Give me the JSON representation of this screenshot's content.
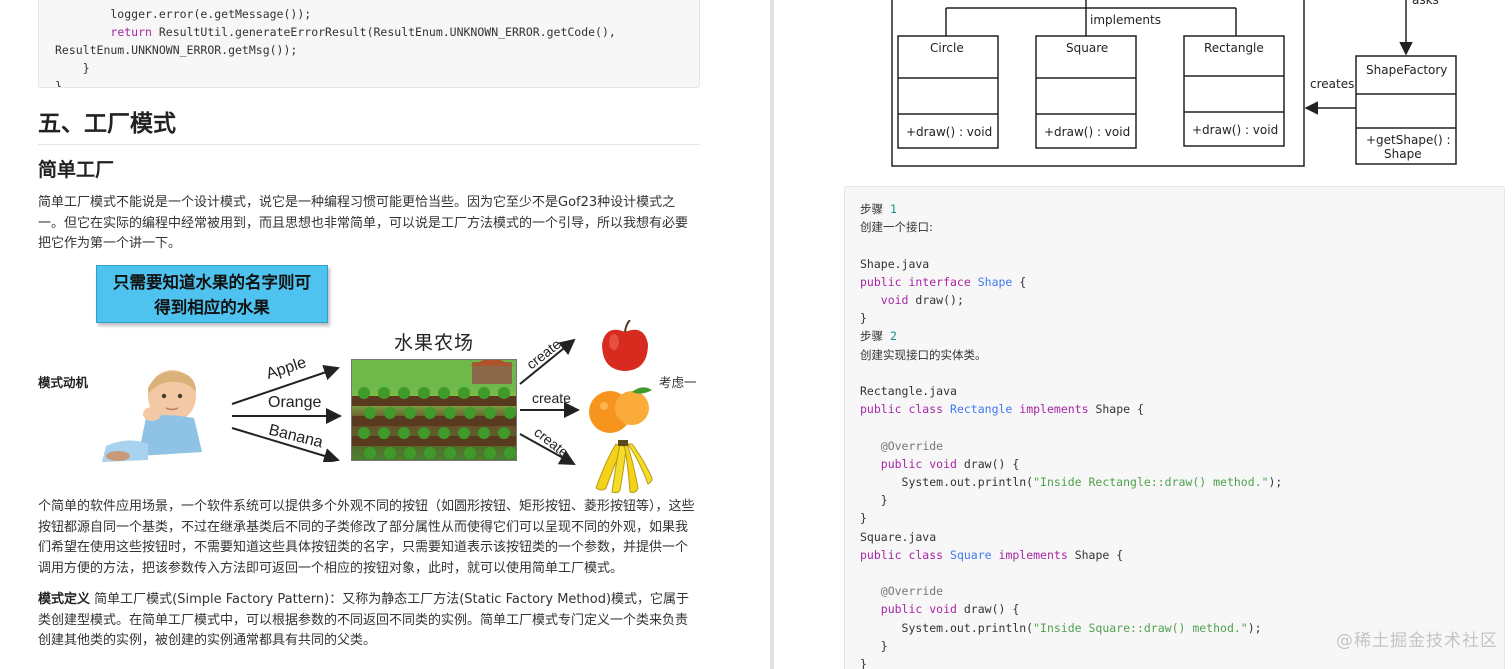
{
  "left": {
    "code_lines": [
      "        logger.error(e.getMessage());",
      "        return ResultUtil.generateErrorResult(ResultEnum.UNKNOWN_ERROR.getCode(),",
      "ResultEnum.UNKNOWN_ERROR.getMsg());",
      "    }",
      "}"
    ],
    "heading": "五、工厂模式",
    "subheading": "简单工厂",
    "intro": "简单工厂模式不能说是一个设计模式，说它是一种编程习惯可能更恰当些。因为它至少不是Gof23种设计模式之一。但它在实际的编程中经常被用到，而且思想也非常简单，可以说是工厂方法模式的一个引导，所以我想有必要把它作为第一个讲一下。",
    "figure": {
      "caption_line1": "只需要知道水果的名字则可",
      "caption_line2": "得到相应的水果",
      "farm_title": "水果农场",
      "inputs": [
        "Apple",
        "Orange",
        "Banana"
      ],
      "create_labels": [
        "create",
        "create",
        "create"
      ]
    },
    "motivation_label": "模式动机",
    "motivation_tail": "考虑一",
    "motivation_text": "个简单的软件应用场景，一个软件系统可以提供多个外观不同的按钮（如圆形按钮、矩形按钮、菱形按钮等），这些按钮都源自同一个基类，不过在继承基类后不同的子类修改了部分属性从而使得它们可以呈现不同的外观，如果我们希望在使用这些按钮时，不需要知道这些具体按钮类的名字，只需要知道表示该按钮类的一个参数，并提供一个调用方便的方法，把该参数传入方法即可返回一个相应的按钮对象，此时，就可以使用简单工厂模式。",
    "definition_label": "模式定义",
    "definition_text": "简单工厂模式(Simple Factory Pattern)：又称为静态工厂方法(Static Factory Method)模式，它属于类创建型模式。在简单工厂模式中，可以根据参数的不同返回不同类的实例。简单工厂模式专门定义一个类来负责创建其他类的实例，被创建的实例通常都具有共同的父类。"
  },
  "right": {
    "uml": {
      "implements_label": "implements",
      "asks_label": "asks",
      "creates_label": "creates",
      "classes": [
        {
          "name": "Circle",
          "method": "+draw() : void"
        },
        {
          "name": "Square",
          "method": "+draw() : void"
        },
        {
          "name": "Rectangle",
          "method": "+draw() : void"
        }
      ],
      "factory": {
        "name": "ShapeFactory",
        "method_line1": "+getShape() :",
        "method_line2": "Shape"
      }
    },
    "code": {
      "step_word": "步骤",
      "step1_num": "1",
      "step1_text": "创建一个接口:",
      "file1": "Shape.java",
      "step2_num": "2",
      "step2_text": "创建实现接口的实体类。",
      "file2": "Rectangle.java",
      "file3": "Square.java",
      "override": "@Override",
      "rect_msg": "\"Inside Rectangle::draw() method.\"",
      "square_msg": "\"Inside Square::draw() method.\""
    }
  },
  "watermark": "@稀土掘金技术社区"
}
